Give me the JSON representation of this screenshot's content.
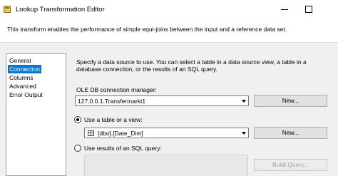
{
  "window": {
    "title": "Lookup Transformation Editor",
    "header_description": "This transform enables the performance of simple equi-joins between the input and a reference data set."
  },
  "nav": {
    "items": [
      {
        "label": "General",
        "selected": false
      },
      {
        "label": "Connection",
        "selected": true
      },
      {
        "label": "Columns",
        "selected": false
      },
      {
        "label": "Advanced",
        "selected": false
      },
      {
        "label": "Error Output",
        "selected": false
      }
    ]
  },
  "connection": {
    "instructions": "Specify a data source to use. You can select a table in a data source view, a table in a database connection, or the results of an SQL query.",
    "manager_label": "OLE DB connection manager:",
    "manager_value": "127.0.0.1.Transfermarkt1",
    "new_button": "New...",
    "use_table_label": "Use a table or a view:",
    "table_value": "[dbo].[Date_Dim]",
    "new_table_button": "New...",
    "use_sql_label": "Use results of an SQL query:",
    "build_query_button": "Build Query...",
    "selected_option": "table"
  }
}
